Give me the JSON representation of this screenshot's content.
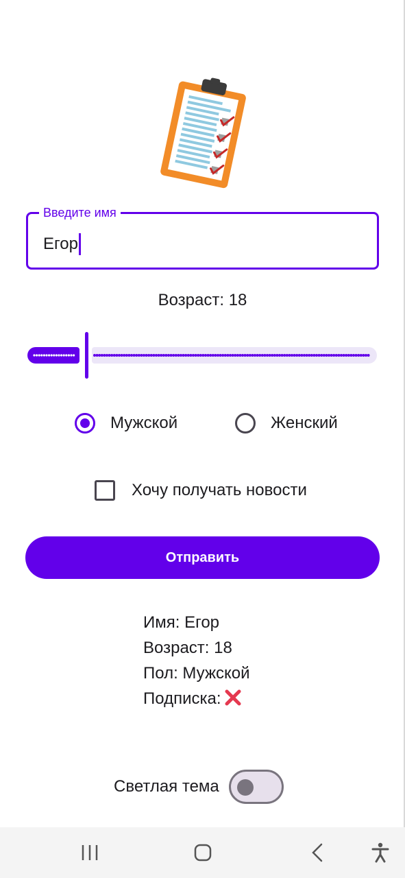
{
  "form": {
    "name_label": "Введите имя",
    "name_value": "Егор",
    "age_label": "Возраст: 18",
    "age_slider_fraction": 0.17,
    "gender_options": [
      {
        "label": "Мужской",
        "selected": true
      },
      {
        "label": "Женский",
        "selected": false
      }
    ],
    "newsletter_label": "Хочу получать новости",
    "newsletter_checked": false,
    "submit_label": "Отправить"
  },
  "summary": {
    "name": "Имя: Егор",
    "age": "Возраст: 18",
    "gender": "Пол: Мужской",
    "subscription": "Подписка:",
    "subscription_icon": "cross-mark-icon"
  },
  "theme": {
    "label": "Светлая тема",
    "enabled": false
  },
  "navigation": {
    "buttons": [
      "recent-apps-icon",
      "home-icon",
      "back-icon",
      "accessibility-icon"
    ]
  },
  "colors": {
    "accent": "#6200ea",
    "accent_light": "#ece6f8",
    "logo_clipboard": "#f28c28",
    "check_red": "#c62828",
    "cross_red": "#e53950"
  }
}
